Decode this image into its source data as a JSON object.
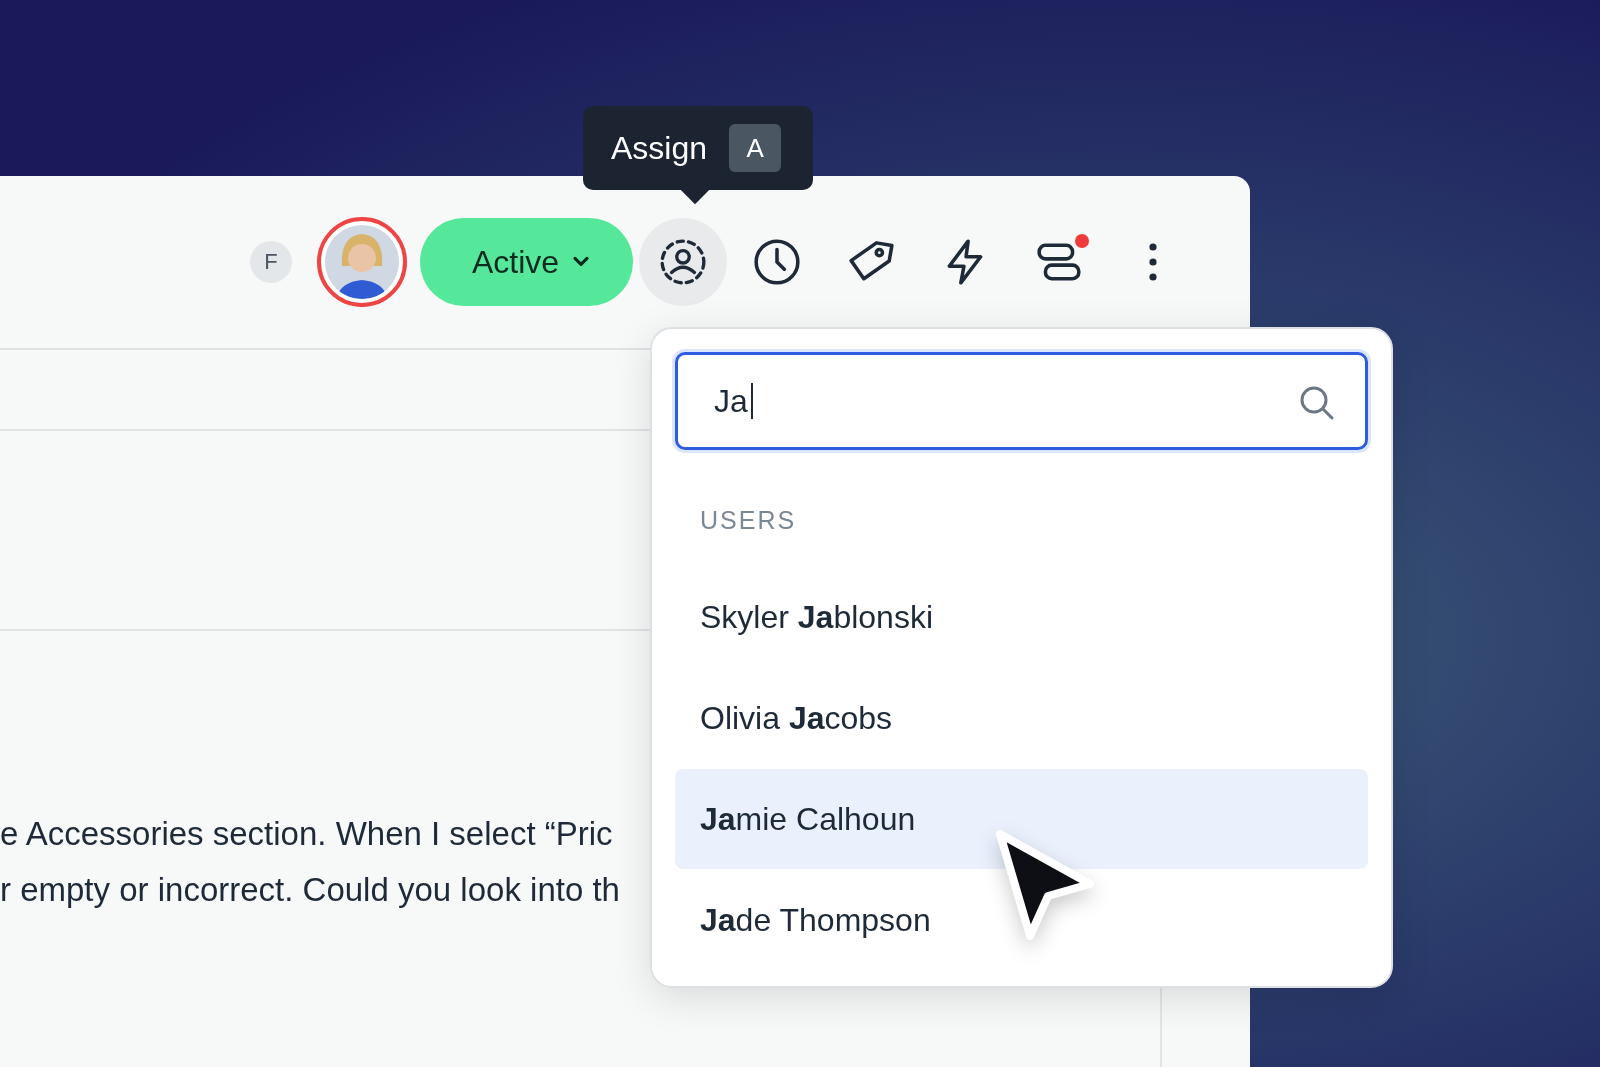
{
  "tooltip": {
    "label": "Assign",
    "shortcut": "A"
  },
  "toolbar": {
    "avatars": [
      {
        "kind": "initial",
        "text": "F"
      },
      {
        "kind": "photo"
      }
    ],
    "status": {
      "label": "Active"
    },
    "tools": [
      {
        "kind": "assign",
        "selected": true,
        "notification": false
      },
      {
        "kind": "clock",
        "selected": false,
        "notification": false
      },
      {
        "kind": "tag",
        "selected": false,
        "notification": false
      },
      {
        "kind": "bolt",
        "selected": false,
        "notification": false
      },
      {
        "kind": "layout",
        "selected": false,
        "notification": true
      },
      {
        "kind": "more",
        "selected": false,
        "notification": false
      }
    ]
  },
  "message_lines": [
    "e Accessories section. When I select “Pric",
    "r empty or incorrect. Could you look into th"
  ],
  "dropdown": {
    "search": {
      "value": "Ja"
    },
    "section": "USERS",
    "users": [
      {
        "name": "Skyler **Ja**blonski",
        "selected": false
      },
      {
        "name": "Olivia **Ja**cobs",
        "selected": false
      },
      {
        "name": "**Ja**mie Calhoun",
        "selected": true
      },
      {
        "name": "**Ja**de Thompson",
        "selected": false
      }
    ]
  }
}
